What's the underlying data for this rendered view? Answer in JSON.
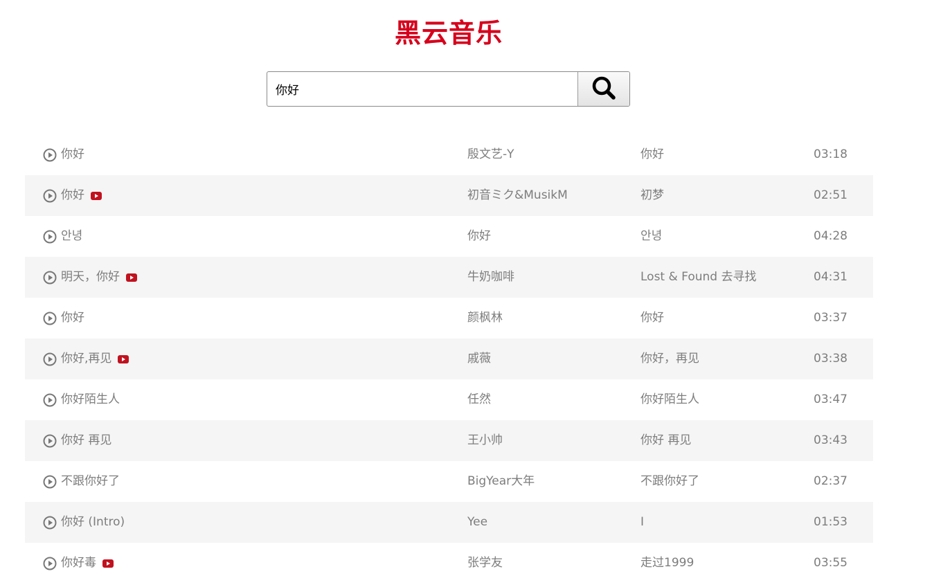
{
  "app": {
    "title": "黑云音乐",
    "brand_color": "#d6001c"
  },
  "search": {
    "value": "你好",
    "placeholder": "",
    "button_icon": "search-icon"
  },
  "results": [
    {
      "title": "你好",
      "has_mv": false,
      "artist": "殷文艺-Y",
      "album": "你好",
      "duration": "03:18"
    },
    {
      "title": "你好",
      "has_mv": true,
      "artist": "初音ミク&MusikM",
      "album": "初梦",
      "duration": "02:51"
    },
    {
      "title": "안녕",
      "has_mv": false,
      "artist": "你好",
      "album": "안녕",
      "duration": "04:28"
    },
    {
      "title": "明天，你好",
      "has_mv": true,
      "artist": "牛奶咖啡",
      "album": "Lost & Found 去寻找",
      "duration": "04:31"
    },
    {
      "title": "你好",
      "has_mv": false,
      "artist": "颜枫林",
      "album": "你好",
      "duration": "03:37"
    },
    {
      "title": "你好,再见",
      "has_mv": true,
      "artist": "戚薇",
      "album": "你好，再见",
      "duration": "03:38"
    },
    {
      "title": "你好陌生人",
      "has_mv": false,
      "artist": "任然",
      "album": "你好陌生人",
      "duration": "03:47"
    },
    {
      "title": "你好 再见",
      "has_mv": false,
      "artist": "王小帅",
      "album": "你好 再见",
      "duration": "03:43"
    },
    {
      "title": "不跟你好了",
      "has_mv": false,
      "artist": "BigYear大年",
      "album": "不跟你好了",
      "duration": "02:37"
    },
    {
      "title": "你好 (Intro)",
      "has_mv": false,
      "artist": "Yee",
      "album": "I",
      "duration": "01:53"
    },
    {
      "title": "你好毒",
      "has_mv": true,
      "artist": "张学友",
      "album": "走过1999",
      "duration": "03:55"
    }
  ],
  "colors": {
    "text": "#7d7d7d",
    "row_alt": "#f5f5f5",
    "mv_badge": "#c1121f"
  }
}
